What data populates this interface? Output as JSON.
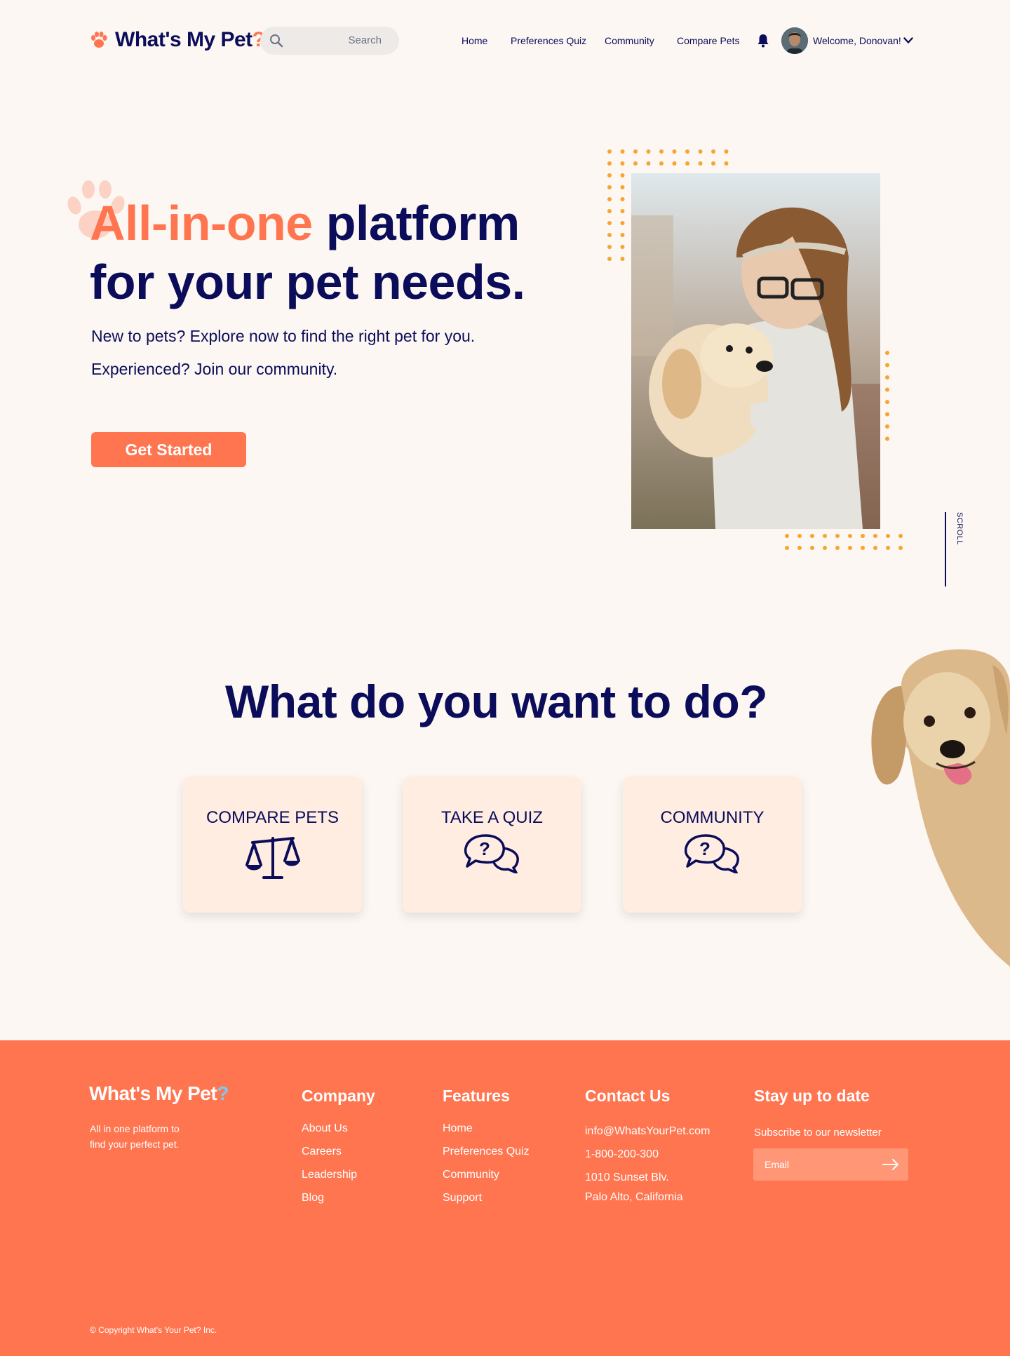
{
  "brand": {
    "name": "What's My Pet",
    "mark": "?"
  },
  "header": {
    "search_placeholder": "Search",
    "nav": [
      "Home",
      "Preferences Quiz",
      "Community",
      "Compare Pets"
    ],
    "welcome": "Welcome, Donovan!"
  },
  "hero": {
    "title_accent": "All-in-one",
    "title_line1_rest": "platform",
    "title_line2": "for your pet needs.",
    "line1": "New to pets? Explore now to find the right pet for you.",
    "line2": "Experienced? Join our community.",
    "cta": "Get Started",
    "scroll": "SCROLL"
  },
  "actions": {
    "title": "What do you want to do?",
    "cards": [
      {
        "label": "COMPARE PETS",
        "icon": "scales-icon"
      },
      {
        "label": "TAKE A QUIZ",
        "icon": "question-chat-icon"
      },
      {
        "label": "COMMUNITY",
        "icon": "question-chat-icon"
      }
    ]
  },
  "footer": {
    "brand": "What's My Pet",
    "brand_mark": "?",
    "tagline": "All in one platform to find your perfect pet.",
    "company": {
      "heading": "Company",
      "links": [
        "About Us",
        "Careers",
        "Leadership",
        "Blog"
      ]
    },
    "features": {
      "heading": "Features",
      "links": [
        "Home",
        "Preferences Quiz",
        "Community",
        "Support"
      ]
    },
    "contact": {
      "heading": "Contact Us",
      "email": "info@WhatsYourPet.com",
      "phone": "1-800-200-300",
      "address1": "1010 Sunset Blv.",
      "address2": "Palo Alto, California"
    },
    "newsletter": {
      "heading": "Stay up to date",
      "text": "Subscribe to our newsletter",
      "placeholder": "Email"
    },
    "copyright": "© Copyright What's Your Pet? Inc."
  },
  "colors": {
    "accent": "#FF7550",
    "navy": "#0B0C5A",
    "background": "#FCF7F2",
    "card": "#FFEDE1",
    "dots": "#F7A531"
  }
}
